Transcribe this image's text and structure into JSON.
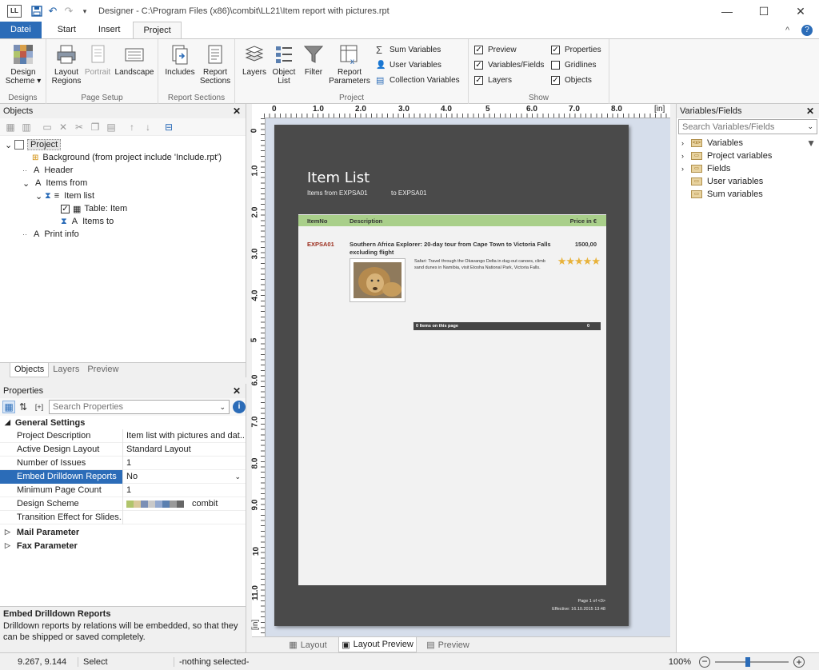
{
  "titlebar": {
    "logo": "LL",
    "title": "Designer - C:\\Program Files (x86)\\combit\\LL21\\Item report with pictures.rpt",
    "minimize": "—",
    "maximize": "☐",
    "close": "✕"
  },
  "tabs": {
    "file": "Datei",
    "start": "Start",
    "insert": "Insert",
    "project": "Project"
  },
  "ribbon": {
    "design_scheme": "Design\nScheme ▾",
    "layout_regions": "Layout\nRegions",
    "portrait": "Portrait",
    "landscape": "Landscape",
    "includes": "Includes",
    "report_sections": "Report\nSections",
    "layers": "Layers",
    "object_list": "Object\nList",
    "filter": "Filter",
    "report_parameters": "Report\nParameters",
    "sum_variables": "Sum Variables",
    "user_variables": "User Variables",
    "collection_variables": "Collection Variables",
    "preview": "Preview",
    "variables_fields": "Variables/Fields",
    "layers_chk": "Layers",
    "properties": "Properties",
    "gridlines": "Gridlines",
    "objects": "Objects",
    "group_designs": "Designs",
    "group_page_setup": "Page Setup",
    "group_report_sections": "Report Sections",
    "group_project": "Project",
    "group_show": "Show"
  },
  "objects_panel": {
    "title": "Objects",
    "tree": {
      "project": "Project",
      "background": "Background (from project include 'Include.rpt')",
      "header": "Header",
      "items_from": "Items from",
      "item_list": "Item list",
      "table_item": "Table: Item",
      "items_to": "Items to",
      "print_info": "Print info"
    },
    "tabs": {
      "objects": "Objects",
      "layers": "Layers",
      "preview": "Preview"
    }
  },
  "properties_panel": {
    "title": "Properties",
    "search_placeholder": "Search Properties",
    "general": "General Settings",
    "rows": [
      {
        "name": "Project Description",
        "value": "Item list with pictures and dat..."
      },
      {
        "name": "Active Design Layout",
        "value": "Standard Layout"
      },
      {
        "name": "Number of Issues",
        "value": "1"
      },
      {
        "name": "Embed Drilldown Reports",
        "value": "No"
      },
      {
        "name": "Minimum Page Count",
        "value": "1"
      },
      {
        "name": "Design Scheme",
        "value": "combit"
      },
      {
        "name": "Transition Effect for Slides...",
        "value": ""
      }
    ],
    "mail": "Mail Parameter",
    "fax": "Fax Parameter",
    "help_title": "Embed Drilldown Reports",
    "help_text": "Drilldown reports by relations will be embedded, so that they can be shipped or saved completely."
  },
  "canvas": {
    "ruler_h": [
      "0",
      "1.0",
      "2.0",
      "3.0",
      "4.0",
      "5",
      "6.0",
      "7.0",
      "8.0",
      "[in]"
    ],
    "ruler_v": [
      "0",
      "1.0",
      "2.0",
      "3.0",
      "4.0",
      "5",
      "6.0",
      "7.0",
      "8.0",
      "9.0",
      "10",
      "11.0",
      "[in]"
    ],
    "report_title": "Item List",
    "report_subtitle_from": "Items from EXPSA01",
    "report_subtitle_to": "to EXPSA01",
    "col_itemno": "ItemNo",
    "col_desc": "Description",
    "col_price": "Price in €",
    "item_no": "EXPSA01",
    "item_title": "Southern Africa Explorer: 20-day tour from Cape Town to Victoria Falls excluding flight",
    "item_price": "1500,00",
    "item_text": "Safari: Travel through the Okavango Delta in dug-out canoes, climb sand dunes in Namibia, visit Etosha National Park, Victoria Falls.",
    "stars": "★★★★★",
    "footer_count": "0 Items on this page",
    "footer_zero": "0",
    "page_info": "Page 1 of <0>",
    "effective": "Effective: 16.10.2015 13:48",
    "view_tabs": {
      "layout": "Layout",
      "layout_preview": "Layout Preview",
      "preview": "Preview"
    }
  },
  "variables_panel": {
    "title": "Variables/Fields",
    "search_placeholder": "Search Variables/Fields",
    "items": [
      "Variables",
      "Project variables",
      "Fields",
      "User variables",
      "Sum variables"
    ]
  },
  "status": {
    "coords": "9.267, 9.144",
    "mode": "Select",
    "selection": "-nothing selected-",
    "zoom": "100%"
  },
  "colors": {
    "accent": "#2b6cb8",
    "page_dark": "#4a4a4a",
    "header_green": "#a9cf8a",
    "item_red": "#9b2c1c",
    "selection_blue": "#2b6cb8"
  }
}
